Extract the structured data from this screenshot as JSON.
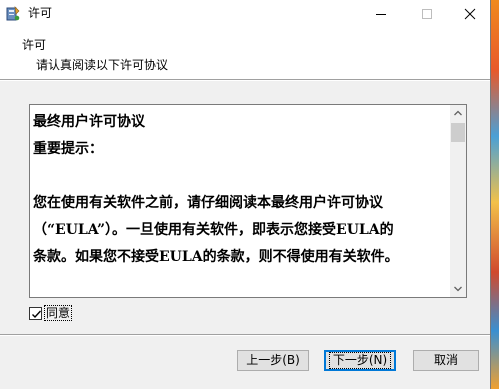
{
  "window": {
    "title": "许可",
    "controls": {
      "minimize_icon": "minimize-icon",
      "maximize_icon": "maximize-icon",
      "close_icon": "close-icon"
    }
  },
  "header": {
    "title": "许可",
    "subtitle": "请认真阅读以下许可协议"
  },
  "eula": {
    "lines": [
      "最终用户许可协议",
      "重要提示：",
      "",
      "您在使用有关软件之前，请仔细阅读本最终用户许可协议",
      "（“EULA”）。一旦使用有关软件，即表示您接受EULA的",
      "条款。如果您不接受EULA的条款，则不得使用有关软件。"
    ]
  },
  "agree": {
    "label": "同意",
    "checked": true
  },
  "buttons": {
    "back": "上一步(B)",
    "next": "下一步(N)",
    "cancel": "取消"
  },
  "colors": {
    "default_button_border": "#0078d7",
    "window_bg": "#f0f0f0",
    "content_bg": "#ffffff"
  }
}
